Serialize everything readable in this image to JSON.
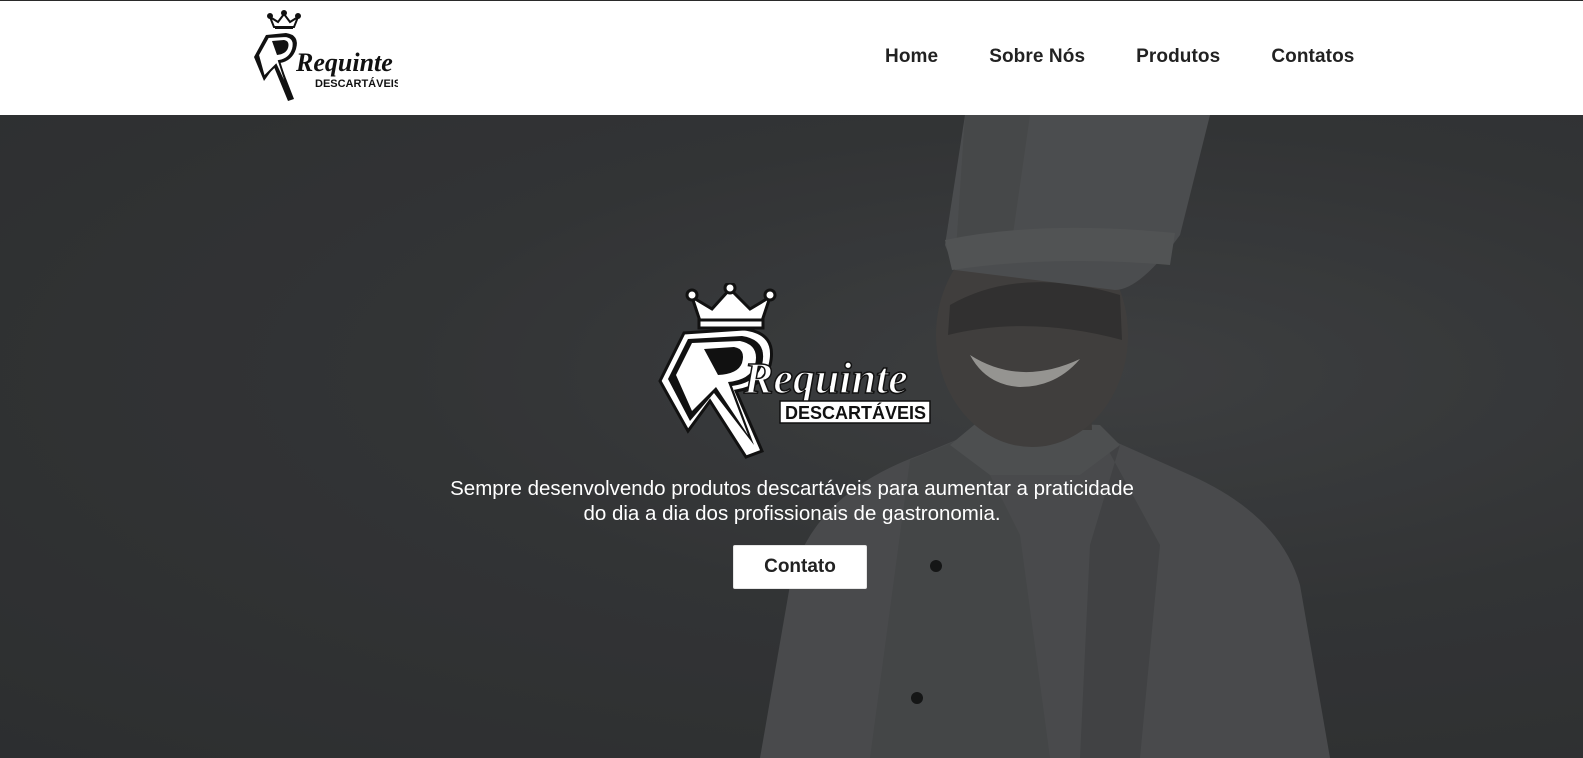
{
  "header": {
    "logo": {
      "wordmark": "Requinte",
      "sub": "DESCARTÁVEIS",
      "icon": "crown-icon"
    },
    "nav": [
      {
        "label": "Home"
      },
      {
        "label": "Sobre Nós"
      },
      {
        "label": "Produtos"
      },
      {
        "label": "Contatos"
      }
    ]
  },
  "hero": {
    "logo": {
      "wordmark": "Requinte",
      "sub": "DESCARTÁVEIS",
      "icon": "crown-icon"
    },
    "tagline_line1": "Sempre desenvolvendo produtos descartáveis para aumentar a praticidade",
    "tagline_line2": "do dia a dia dos profissionais de gastronomia.",
    "cta_label": "Contato"
  },
  "colors": {
    "header_bg": "#ffffff",
    "hero_bg": "#3a3b3d",
    "text_dark": "#222222",
    "text_light": "#ffffff"
  }
}
